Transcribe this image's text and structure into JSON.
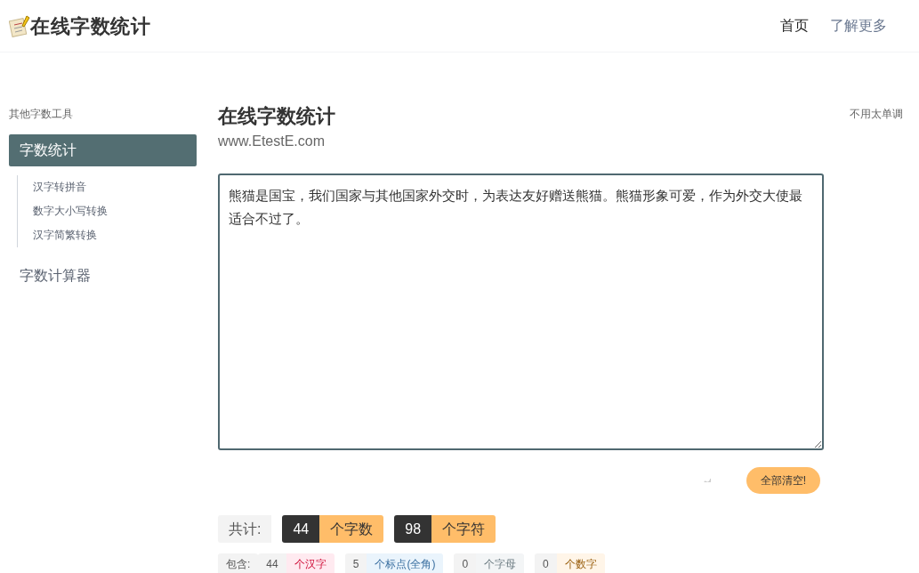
{
  "header": {
    "logo": "在线字数统计",
    "nav": [
      {
        "label": "首页",
        "selected": true
      },
      {
        "label": "了解更多",
        "selected": false
      }
    ]
  },
  "sidebar": {
    "heading": "其他字数工具",
    "items": [
      {
        "label": "字数统计",
        "selected": true,
        "children": [
          {
            "label": "汉字转拼音"
          },
          {
            "label": "数字大小写转换"
          },
          {
            "label": "汉字简繁转换"
          }
        ]
      },
      {
        "label": "字数计算器",
        "selected": false
      }
    ]
  },
  "main": {
    "title": "在线字数统计",
    "subtitle": "www.EtestE.com",
    "aside": "不用太单调",
    "textarea": {
      "value": "熊猫是国宝，我们国家与其他国家外交时，为表达友好赠送熊猫。熊猫形象可爱，作为外交大使最适合不过了。"
    },
    "clear_button": "全部清空!",
    "totals": {
      "label": "共计:",
      "items": [
        {
          "count": "44",
          "unit": "个字数"
        },
        {
          "count": "98",
          "unit": "个字符"
        }
      ]
    },
    "breakdown": {
      "label": "包含:",
      "items": [
        {
          "kind": "hanzi",
          "count": "44",
          "unit": "个汉字"
        },
        {
          "kind": "punctuation",
          "count": "5",
          "unit": "个标点(全角)"
        },
        {
          "kind": "letter",
          "count": "0",
          "unit": "个字母"
        },
        {
          "kind": "digit",
          "count": "0",
          "unit": "个数字"
        }
      ]
    }
  }
}
